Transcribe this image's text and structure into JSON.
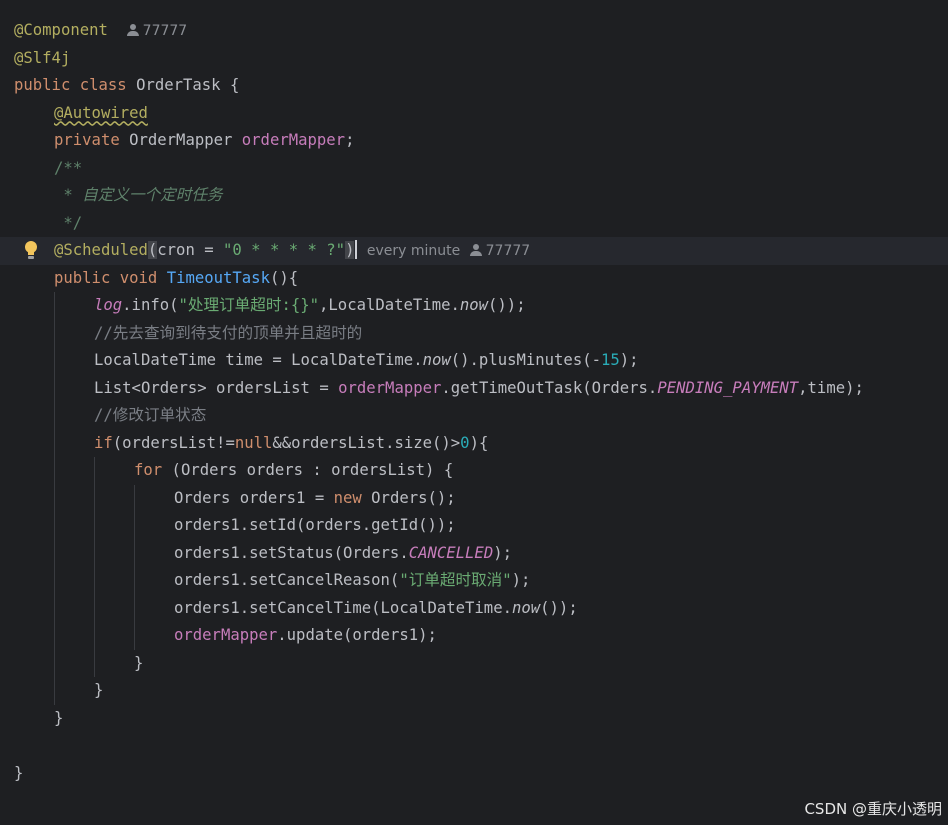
{
  "tokens": {
    "l1_ann": "@Component",
    "l1_author": "77777",
    "l2_ann": "@Slf4j",
    "l3_public": "public",
    "l3_class": "class",
    "l3_name": "OrderTask {",
    "l4_ann": "@Autowired",
    "l5_private": "private",
    "l5_type": "OrderMapper",
    "l5_field": "orderMapper",
    "l5_semi": ";",
    "l6_doc": "/**",
    "l7_doc": " * 自定义一个定时任务",
    "l8_doc": " */",
    "l9_ann": "@Scheduled",
    "l9_lparen": "(",
    "l9_param": "cron = ",
    "l9_str": "\"0 * * * * ?\"",
    "l9_rparen": ")",
    "l9_hint": "every minute",
    "l9_author": "77777",
    "l10_public": "public",
    "l10_void": "void",
    "l10_fn": "TimeoutTask",
    "l10_rest": "(){",
    "l11_log": "log",
    "l11_info": ".info(",
    "l11_str": "\"处理订单超时:{}\"",
    "l11_mid": ",LocalDateTime.",
    "l11_now": "now",
    "l11_end": "());",
    "l12_cmt": "//先去查询到待支付的顶单并且超时的",
    "l13_a": "LocalDateTime time = LocalDateTime.",
    "l13_now": "now",
    "l13_b": "().plusMinutes(-",
    "l13_num": "15",
    "l13_c": ");",
    "l14_a": "List<Orders> ordersList = ",
    "l14_field": "orderMapper",
    "l14_b": ".getTimeOutTask(Orders.",
    "l14_const": "PENDING_PAYMENT",
    "l14_c": ",time);",
    "l15_cmt": "//修改订单状态",
    "l16_if": "if",
    "l16_a": "(ordersList!=",
    "l16_null": "null",
    "l16_b": "&&ordersList.size()>",
    "l16_num": "0",
    "l16_c": "){",
    "l17_for": "for",
    "l17_a": " (Orders orders : ordersList) {",
    "l18_a": "Orders orders1 = ",
    "l18_new": "new",
    "l18_b": " Orders();",
    "l19": "orders1.setId(orders.getId());",
    "l20_a": "orders1.setStatus(Orders.",
    "l20_const": "CANCELLED",
    "l20_b": ");",
    "l21_a": "orders1.setCancelReason(",
    "l21_str": "\"订单超时取消\"",
    "l21_b": ");",
    "l22_a": "orders1.setCancelTime(LocalDateTime.",
    "l22_now": "now",
    "l22_b": "());",
    "l23_field": "orderMapper",
    "l23_a": ".update(orders1);",
    "l24": "}",
    "l25": "}",
    "l26": "}",
    "l28": "}"
  },
  "watermark": "CSDN @重庆小透明",
  "colors": {
    "background": "#1e1f22",
    "annotation": "#b3ae60",
    "keyword": "#cf8e6d",
    "field": "#c77dbb",
    "string": "#6aab73",
    "number": "#2aacb8",
    "method": "#56a8f5",
    "comment": "#7a7e85",
    "doc_comment": "#5f826b"
  },
  "icons": {
    "gutter": "lightbulb-icon",
    "author": "user-icon"
  }
}
